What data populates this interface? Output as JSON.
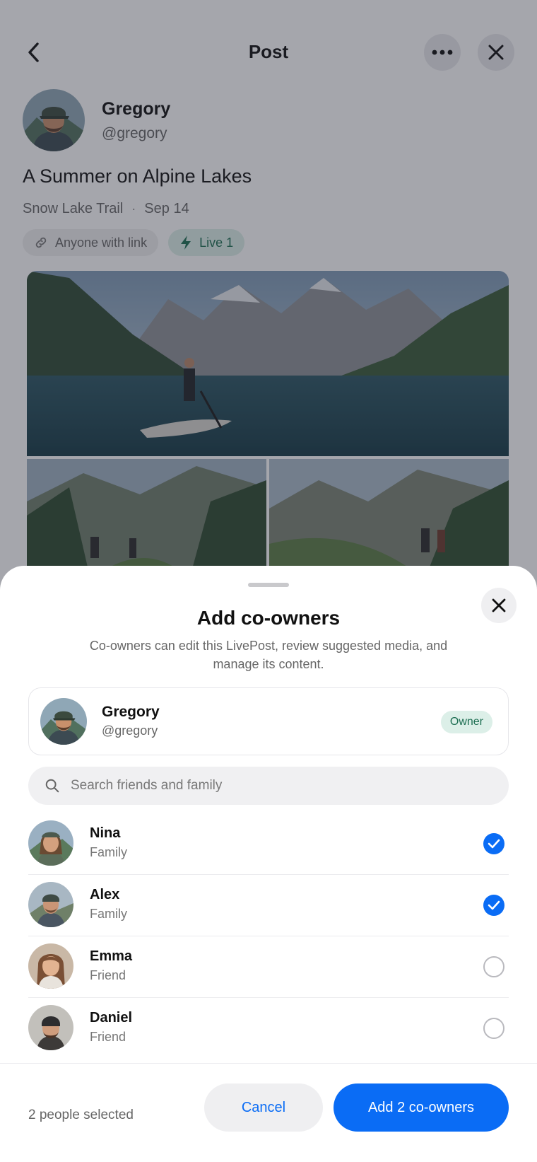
{
  "header": {
    "title": "Post",
    "back_icon": "chevron-left-icon",
    "more_icon": "more-horizontal-icon",
    "close_icon": "close-icon"
  },
  "post": {
    "author_name": "Gregory",
    "author_handle": "@gregory",
    "title": "A Summer on Alpine Lakes",
    "location": "Snow Lake Trail",
    "separator": "·",
    "date": "Sep 14",
    "chips": {
      "visibility": "Anyone with link",
      "visibility_icon": "link-icon",
      "live": "Live 1",
      "live_icon": "lightning-icon"
    }
  },
  "sheet": {
    "title": "Add co-owners",
    "description": "Co-owners can edit this LivePost, review suggested media, and manage its content.",
    "owner": {
      "name": "Gregory",
      "handle": "@gregory",
      "badge": "Owner"
    },
    "search": {
      "placeholder": "Search friends and family",
      "value": ""
    },
    "people": [
      {
        "name": "Nina",
        "relation": "Family",
        "selected": true
      },
      {
        "name": "Alex",
        "relation": "Family",
        "selected": true
      },
      {
        "name": "Emma",
        "relation": "Friend",
        "selected": false
      },
      {
        "name": "Daniel",
        "relation": "Friend",
        "selected": false
      }
    ],
    "footer": {
      "selected_count": "2 people selected",
      "cancel_label": "Cancel",
      "add_label": "Add 2 co-owners"
    }
  },
  "colors": {
    "accent": "#0a6cf5",
    "owner_badge_bg": "#dcefe8",
    "owner_badge_text": "#1d6e52"
  }
}
